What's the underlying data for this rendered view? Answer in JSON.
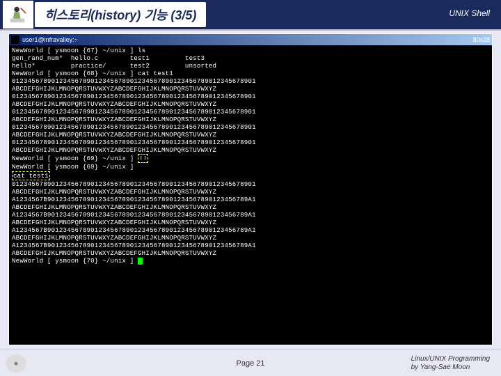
{
  "header": {
    "title": "히스토리(history) 기능 (3/5)",
    "right": "UNIX Shell"
  },
  "termTitle": {
    "left": "user1@infravalley:~",
    "right": "80x28"
  },
  "terminal": {
    "l01": "NewWorld [ ysmoon {67} ~/unix ] ls",
    "l02": "gen_rand_num*  hello.c        test1         test3",
    "l03": "hello*         practice/      test2         unsorted",
    "l04": "NewWorld [ ysmoon {68} ~/unix ] cat test1",
    "l05": "01234567890123456789012345678901234567890123456789012345678901",
    "l06": "ABCDEFGHIJKLMNOPQRSTUVWXYZABCDEFGHIJKLMNOPQRSTUVWXYZ",
    "l07": "01234567890123456789012345678901234567890123456789012345678901",
    "l08": "ABCDEFGHIJKLMNOPQRSTUVWXYZABCDEFGHIJKLMNOPQRSTUVWXYZ",
    "l09": "01234567890123456789012345678901234567890123456789012345678901",
    "l10": "ABCDEFGHIJKLMNOPQRSTUVWXYZABCDEFGHIJKLMNOPQRSTUVWXYZ",
    "l11": "01234567890123456789012345678901234567890123456789012345678901",
    "l12": "ABCDEFGHIJKLMNOPQRSTUVWXYZABCDEFGHIJKLMNOPQRSTUVWXYZ",
    "l13": "01234567890123456789012345678901234567890123456789012345678901",
    "l14": "ABCDEFGHIJKLMNOPQRSTUVWXYZABCDEFGHIJKLMNOPQRSTUVWXYZ",
    "l15a": "NewWorld [ ysmoon {69} ~/unix ] ",
    "l15b": "!!",
    "l16": "NewWorld [ ysmoon {69} ~/unix ]",
    "l17": "cat test1",
    "l18": "01234567890123456789012345678901234567890123456789012345678901",
    "l19": "ABCDEFGHIJKLMNOPQRSTUVWXYZABCDEFGHIJKLMNOPQRSTUVWXYZ",
    "l20": "A1234567B901234567890123456789012345678901234567890123456789A1",
    "l21": "ABCDEFGHIJKLMNOPQRSTUVWXYZABCDEFGHIJKLMNOPQRSTUVWXYZ",
    "l22": "A1234567B901234567890123456789012345678901234567890123456789A1",
    "l23": "ABCDEFGHIJKLMNOPQRSTUVWXYZABCDEFGHIJKLMNOPQRSTUVWXYZ",
    "l24": "A1234567B901234567890123456789012345678901234567890123456789A1",
    "l25": "ABCDEFGHIJKLMNOPQRSTUVWXYZABCDEFGHIJKLMNOPQRSTUVWXYZ",
    "l26": "A1234567B901234567890123456789012345678901234567890123456789A1",
    "l27": "ABCDEFGHIJKLMNOPQRSTUVWXYZABCDEFGHIJKLMNOPQRSTUVWXYZ",
    "l28": "NewWorld [ ysmoon {70} ~/unix ] "
  },
  "footer": {
    "page": "Page 21",
    "course": "Linux/UNIX Programming",
    "author": "by Yang-Sae Moon"
  }
}
